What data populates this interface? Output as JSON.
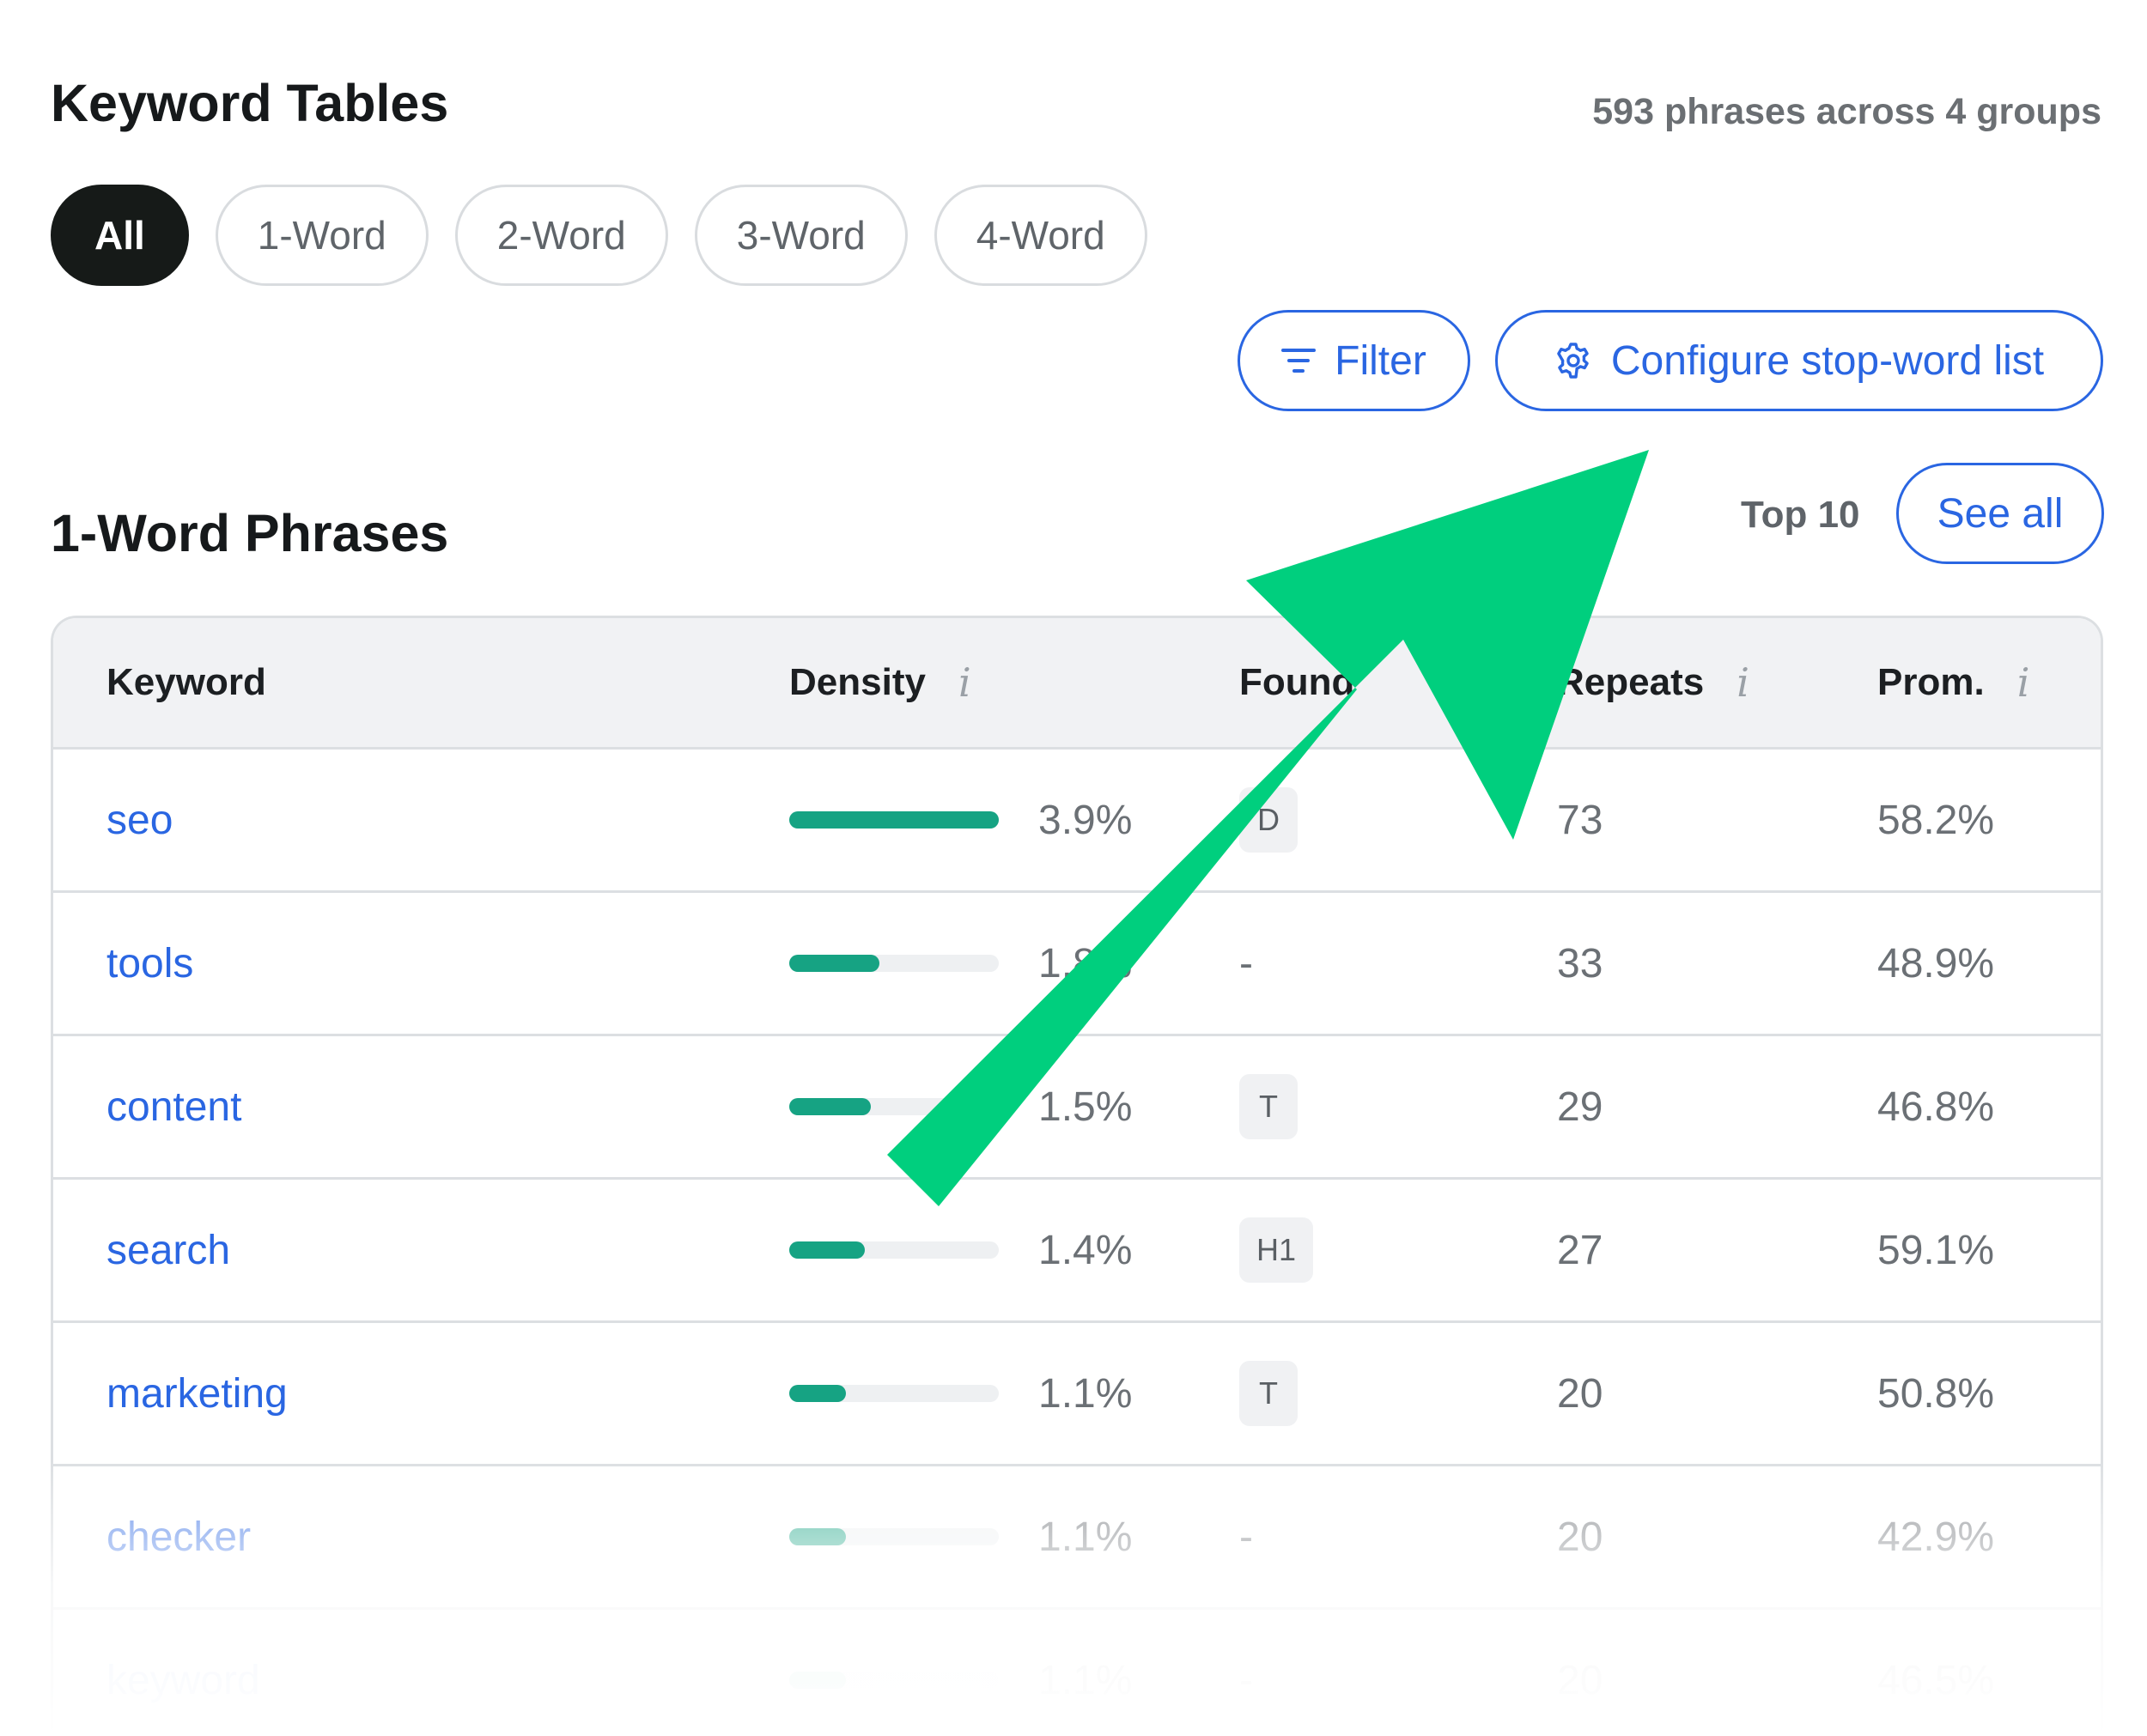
{
  "header": {
    "title": "Keyword Tables",
    "summary": "593 phrases across 4 groups"
  },
  "tabs": [
    {
      "label": "All",
      "active": true
    },
    {
      "label": "1-Word",
      "active": false
    },
    {
      "label": "2-Word",
      "active": false
    },
    {
      "label": "3-Word",
      "active": false
    },
    {
      "label": "4-Word",
      "active": false
    }
  ],
  "toolbar": {
    "filter_label": "Filter",
    "configure_label": "Configure stop-word list"
  },
  "section": {
    "title": "1-Word Phrases",
    "top_label": "Top 10",
    "see_all_label": "See all"
  },
  "table": {
    "columns": {
      "keyword": "Keyword",
      "density": "Density",
      "found": "Found",
      "repeats": "Repeats",
      "prom": "Prom."
    },
    "rows": [
      {
        "keyword": "seo",
        "density": "3.9%",
        "density_fraction": 1.0,
        "found": "D",
        "repeats": "73",
        "prom": "58.2%"
      },
      {
        "keyword": "tools",
        "density": "1.8%",
        "density_fraction": 0.43,
        "found": "-",
        "repeats": "33",
        "prom": "48.9%"
      },
      {
        "keyword": "content",
        "density": "1.5%",
        "density_fraction": 0.39,
        "found": "T",
        "repeats": "29",
        "prom": "46.8%"
      },
      {
        "keyword": "search",
        "density": "1.4%",
        "density_fraction": 0.36,
        "found": "H1",
        "repeats": "27",
        "prom": "59.1%"
      },
      {
        "keyword": "marketing",
        "density": "1.1%",
        "density_fraction": 0.27,
        "found": "T",
        "repeats": "20",
        "prom": "50.8%"
      },
      {
        "keyword": "checker",
        "density": "1.1%",
        "density_fraction": 0.27,
        "found": "-",
        "repeats": "20",
        "prom": "42.9%"
      },
      {
        "keyword": "keyword",
        "density": "1.1%",
        "density_fraction": 0.27,
        "found": "-",
        "repeats": "20",
        "prom": "46.5%"
      }
    ]
  },
  "colors": {
    "accent": "#2a66e2",
    "bar": "#16a383",
    "arrow": "#00cf7e"
  },
  "icons": {
    "filter": "filter-icon",
    "configure": "gear-icon",
    "info": "info-icon",
    "annotation": "arrow-annotation"
  }
}
